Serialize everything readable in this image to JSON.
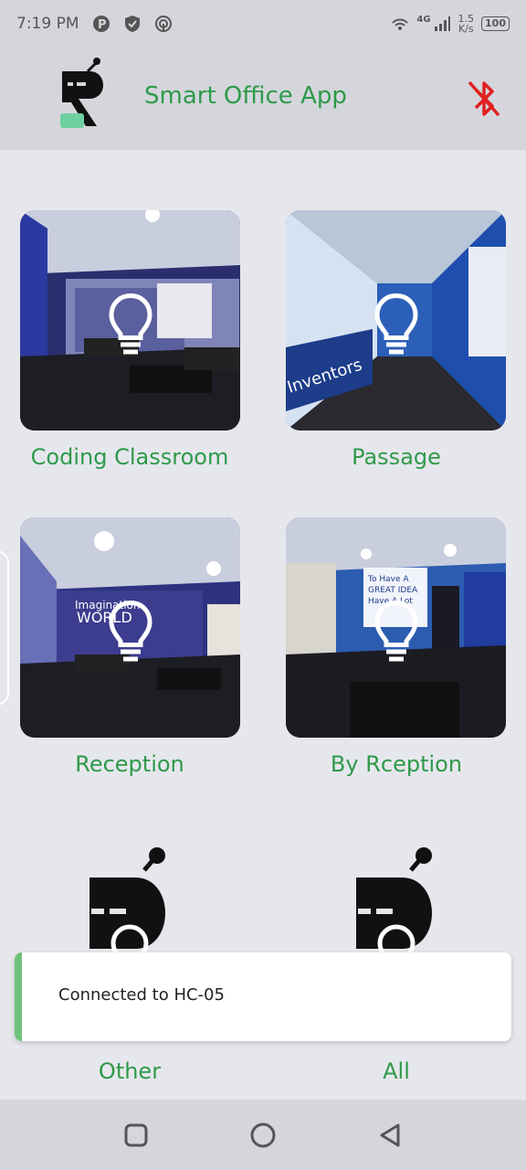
{
  "status_bar": {
    "time": "7:19 PM",
    "network": "4G",
    "speed_value": "1.5",
    "speed_unit": "K/s",
    "battery": "100",
    "left_icons": [
      "parking-icon",
      "shield-icon",
      "hotspot-icon"
    ],
    "right_icons": [
      "wifi-icon",
      "signal-icon"
    ]
  },
  "header": {
    "title": "Smart Office App",
    "bluetooth_state": "disconnected",
    "accent_color": "#2e9a4a",
    "bluetooth_color": "#e02020"
  },
  "rooms": [
    {
      "label": "Coding Classroom",
      "light": "off"
    },
    {
      "label": "Passage",
      "light": "off"
    },
    {
      "label": "Reception",
      "light": "off"
    },
    {
      "label": "By Rception",
      "light": "off"
    },
    {
      "label": "Other",
      "light": "off"
    },
    {
      "label": "All",
      "light": "off"
    }
  ],
  "toast": {
    "message": "Connected to HC-05",
    "accent_color": "#6fc27b"
  },
  "nav": {
    "buttons": [
      "recents-button",
      "home-button",
      "back-button"
    ]
  }
}
